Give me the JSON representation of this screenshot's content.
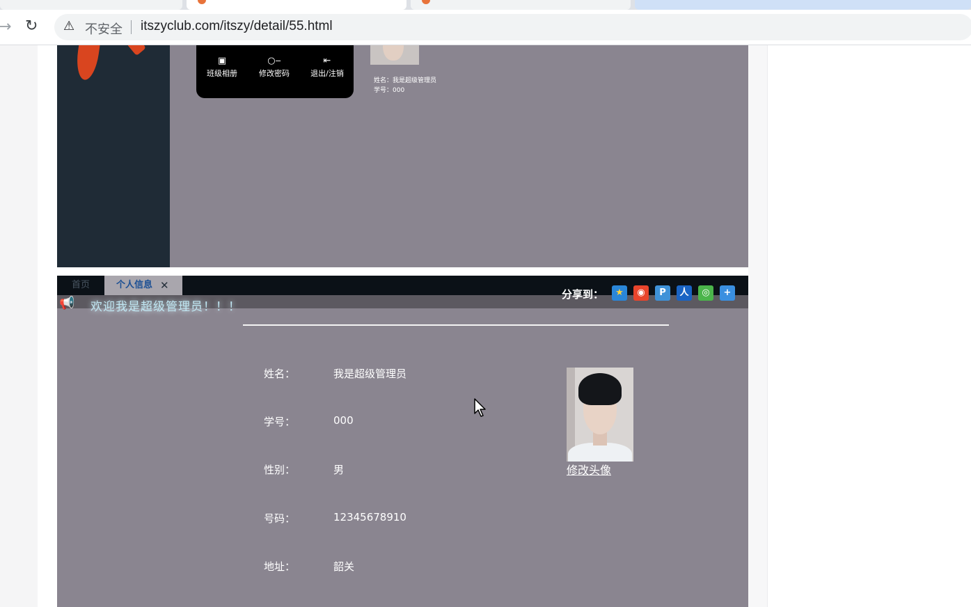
{
  "browser": {
    "security_label": "不安全",
    "url": "itszyclub.com/itszy/detail/55.html"
  },
  "top_frame": {
    "menu": [
      {
        "label": "班级相册",
        "icon": "image-icon"
      },
      {
        "label": "修改密码",
        "icon": "key-icon"
      },
      {
        "label": "退出/注销",
        "icon": "logout-icon"
      }
    ],
    "mini_name": "姓名：我是超级管理员",
    "mini_id": "学号：000"
  },
  "tabs": {
    "home": "首页",
    "active": "个人信息",
    "close": "✕"
  },
  "welcome_text": "欢迎我是超级管理员！！！",
  "share": {
    "label": "分享到：",
    "icons": [
      "qzone-icon",
      "weibo-icon",
      "tencent-weibo-icon",
      "renren-icon",
      "wechat-icon",
      "more-share-icon"
    ]
  },
  "profile": {
    "fields": [
      {
        "key": "姓名：",
        "value": "我是超级管理员"
      },
      {
        "key": "学号：",
        "value": "000"
      },
      {
        "key": "性别：",
        "value": "男"
      },
      {
        "key": "号码：",
        "value": "12345678910"
      },
      {
        "key": "地址：",
        "value": "韶关"
      }
    ],
    "avatar_link": "修改头像"
  }
}
